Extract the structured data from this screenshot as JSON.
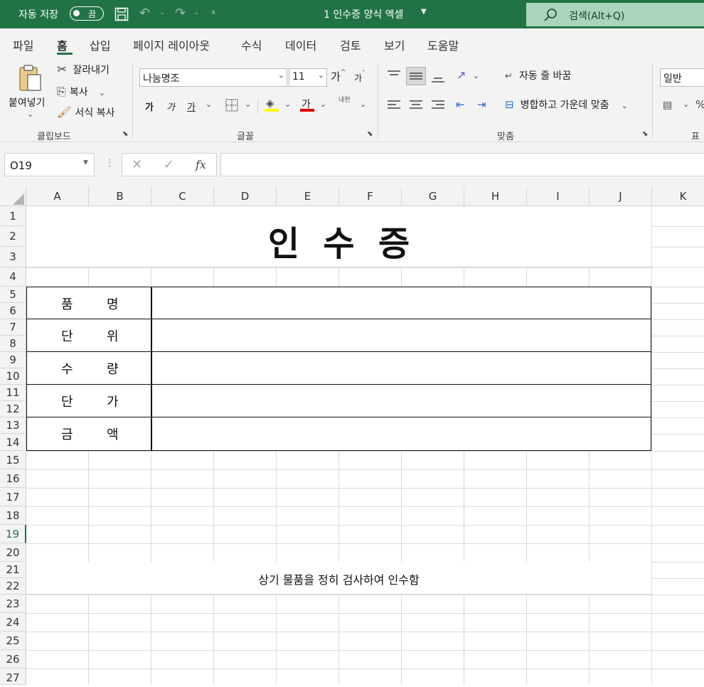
{
  "titlebar": {
    "autosave_label": "자동 저장",
    "autosave_state": "끔",
    "doc_title": "1 인수증 양식 엑셀",
    "search_placeholder": "검색(Alt+Q)"
  },
  "menu": [
    "파일",
    "홈",
    "삽입",
    "페이지 레이아웃",
    "수식",
    "데이터",
    "검토",
    "보기",
    "도움말"
  ],
  "active_menu": "홈",
  "ribbon": {
    "clipboard": {
      "paste": "붙여넣기",
      "cut": "잘라내기",
      "copy": "복사",
      "format_painter": "서식 복사",
      "group": "클립보드"
    },
    "font": {
      "name": "나눔명조",
      "size": "11",
      "grow": "가",
      "shrink": "가",
      "bold": "가",
      "italic": "가",
      "underline": "가",
      "font_color": "가",
      "phonetic": "내천",
      "group": "글꼴"
    },
    "alignment": {
      "wrap": "자동 줄 바꿈",
      "merge": "병합하고 가운데 맞춤",
      "group": "맞춤"
    },
    "number": {
      "format": "일반",
      "group": "표"
    }
  },
  "formula_bar": {
    "name_box": "O19",
    "formula": "",
    "fx": "fx"
  },
  "columns": [
    "A",
    "B",
    "C",
    "D",
    "E",
    "F",
    "G",
    "H",
    "I",
    "J",
    "K"
  ],
  "rows": [
    "1",
    "2",
    "3",
    "4",
    "5",
    "6",
    "7",
    "8",
    "9",
    "10",
    "11",
    "12",
    "13",
    "14",
    "15",
    "16",
    "17",
    "18",
    "19",
    "20",
    "21",
    "22",
    "23",
    "24",
    "25",
    "26",
    "27"
  ],
  "selected_row": "19",
  "sheet": {
    "title": "인  수  증",
    "table_rows": [
      {
        "label_a": "품",
        "label_b": "명",
        "value": ""
      },
      {
        "label_a": "단",
        "label_b": "위",
        "value": ""
      },
      {
        "label_a": "수",
        "label_b": "량",
        "value": ""
      },
      {
        "label_a": "단",
        "label_b": "가",
        "value": ""
      },
      {
        "label_a": "금",
        "label_b": "액",
        "value": ""
      }
    ],
    "footer": "상기 물품을 정히 검사하여 인수함"
  },
  "colors": {
    "brand": "#217346",
    "titlebar": "#217346",
    "search_bg": "#a9d5bd",
    "ribbon_bg": "#f3f3f3",
    "highlight": "#ffff00",
    "font_color": "#e00000"
  }
}
